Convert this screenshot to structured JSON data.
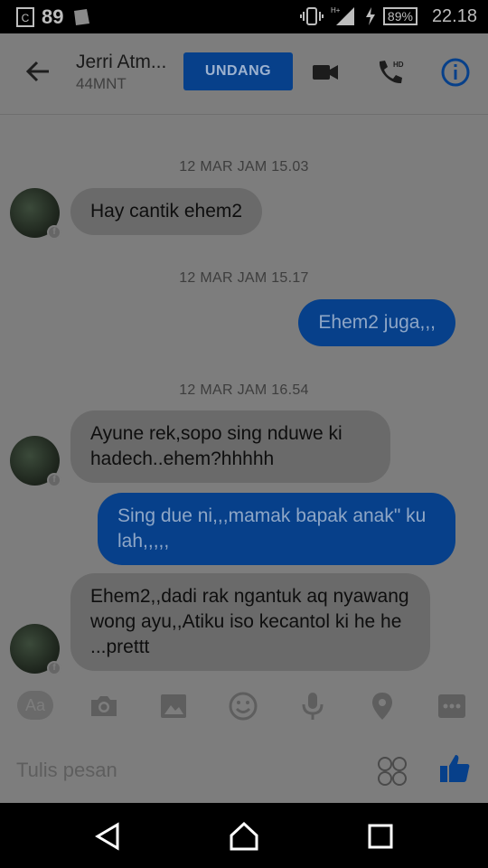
{
  "status_bar": {
    "notification_count": "89",
    "battery": "89%",
    "time": "22.18"
  },
  "header": {
    "contact_name": "Jerri Atm...",
    "contact_status": "44MNT",
    "invite_label": "UNDANG"
  },
  "messages": [
    {
      "type": "timestamp",
      "text": "12 MAR JAM 15.03"
    },
    {
      "type": "incoming",
      "text": "Hay cantik ehem2"
    },
    {
      "type": "timestamp",
      "text": "12 MAR JAM 15.17"
    },
    {
      "type": "outgoing",
      "text": "Ehem2 juga,,,"
    },
    {
      "type": "timestamp",
      "text": "12 MAR JAM 16.54"
    },
    {
      "type": "incoming",
      "text": "Ayune rek,sopo sing nduwe ki hadech..ehem?hhhhh"
    },
    {
      "type": "outgoing",
      "text": "Sing due ni,,,mamak bapak anak\" ku lah,,,,,"
    },
    {
      "type": "incoming",
      "text": "Ehem2,,dadi rak ngantuk aq nyawang wong ayu,,Atiku iso kecantol ki he he ...prettt"
    }
  ],
  "toolbar": {
    "aa_label": "Aa",
    "icons": [
      "text-format-icon",
      "camera-icon",
      "gallery-icon",
      "smiley-icon",
      "microphone-icon",
      "location-icon",
      "more-icon"
    ]
  },
  "composer": {
    "placeholder": "Tulis pesan"
  },
  "colors": {
    "background": "#7d7d7d",
    "accent": "#07408a",
    "incoming_bubble": "#6a6a6a"
  }
}
